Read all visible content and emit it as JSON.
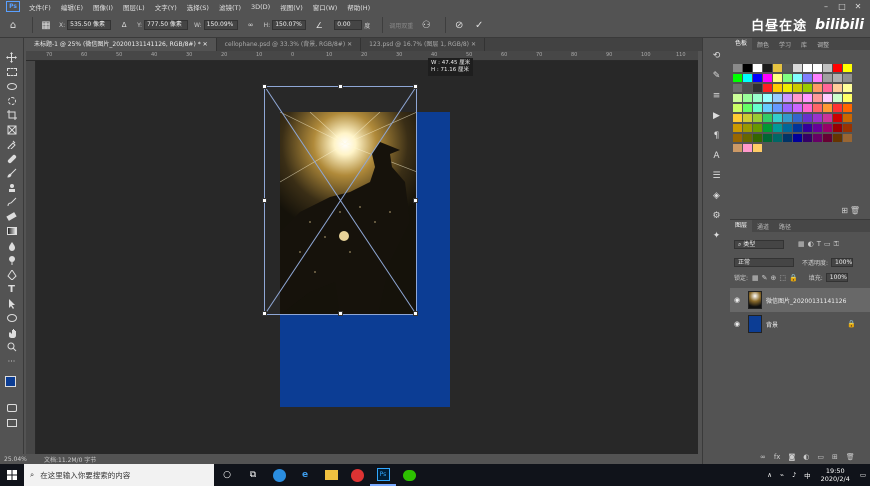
{
  "app": {
    "logo": "Ps"
  },
  "menu": [
    "文件(F)",
    "编辑(E)",
    "图像(I)",
    "图层(L)",
    "文字(Y)",
    "选择(S)",
    "滤镜(T)",
    "3D(D)",
    "视图(V)",
    "窗口(W)",
    "帮助(H)"
  ],
  "options": {
    "x_label": "X:",
    "x_value": "535.50 像素",
    "y_label": "Y:",
    "y_value": "777.50 像素",
    "w_label": "W:",
    "w_value": "150.09%",
    "h_label": "H:",
    "h_value": "150.07%",
    "angle_value": "0.00",
    "angle_unit": "度",
    "interp": "插值: 两次立方",
    "warp_label": "调用双重"
  },
  "watermark": {
    "text": "白昼在途",
    "logo": "bilibili"
  },
  "tabs": [
    {
      "label": "未标题-1 @ 25% (微信图片_20200131141126, RGB/8#) *",
      "active": true
    },
    {
      "label": "cellophane.psd @ 33.3% (背景, RGB/8#)",
      "active": false
    },
    {
      "label": "123.psd @ 16.7% (图层 1, RGB/8)",
      "active": false
    }
  ],
  "ruler_ticks": [
    "70",
    "60",
    "50",
    "40",
    "30",
    "20",
    "10",
    "0",
    "10",
    "20",
    "30",
    "40",
    "50",
    "60",
    "70",
    "80",
    "90",
    "100",
    "110"
  ],
  "tooltip": {
    "w": "W : 47.45 厘米",
    "h": "H : 71.16 厘米"
  },
  "status": {
    "zoom": "25.04%",
    "doc": "文档:11.2M/0 字节"
  },
  "swatch_tabs": [
    "色板",
    "颜色",
    "学习",
    "库",
    "调整"
  ],
  "swatches": [
    "#8a8a8a",
    "#000000",
    "#ffffff",
    "#1a1a1a",
    "#e6c341",
    "#5a5a5a",
    "#d9d9d9",
    "#ffffff",
    "#ffffff",
    "#c0c0c0",
    "#ff0000",
    "#ffff00",
    "#00ff00",
    "#00ffff",
    "#0000ff",
    "#ff00ff",
    "#ffff80",
    "#80ff80",
    "#80ffff",
    "#8080ff",
    "#ff80ff",
    "#a0a0a0",
    "#b0b0b0",
    "#909090",
    "#707070",
    "#505050",
    "#303030",
    "#ff2020",
    "#ffcc00",
    "#eeee00",
    "#cccc00",
    "#99cc00",
    "#ff9966",
    "#ff6699",
    "#ffcc99",
    "#ffff99",
    "#ccff99",
    "#99ff99",
    "#99ffcc",
    "#99ffff",
    "#99ccff",
    "#cc99ff",
    "#ff99cc",
    "#ff99ff",
    "#ff9999",
    "#ffccff",
    "#ccffcc",
    "#ffff66",
    "#ccff66",
    "#66ff66",
    "#66ffcc",
    "#66ccff",
    "#6699ff",
    "#9966ff",
    "#cc66ff",
    "#ff66cc",
    "#ff6666",
    "#ff9933",
    "#ff3333",
    "#ff6600",
    "#ffcc33",
    "#cccc33",
    "#99cc33",
    "#33cc66",
    "#33cccc",
    "#3399cc",
    "#3366cc",
    "#6633cc",
    "#9933cc",
    "#cc3399",
    "#cc0000",
    "#cc6600",
    "#cc9900",
    "#999900",
    "#669900",
    "#009933",
    "#009999",
    "#006699",
    "#003399",
    "#330099",
    "#660099",
    "#990066",
    "#990000",
    "#993300",
    "#996600",
    "#666600",
    "#336600",
    "#006633",
    "#006666",
    "#003366",
    "#000099",
    "#330066",
    "#660066",
    "#660033",
    "#663300",
    "#996633",
    "#cc9966",
    "#ff99cc",
    "#ffcc66"
  ],
  "layers_panel": {
    "tabs": [
      "图层",
      "通道",
      "路径"
    ],
    "filter": "类型",
    "blend_mode": "正常",
    "opacity_label": "不透明度:",
    "opacity": "100%",
    "lock_label": "锁定:",
    "fill_label": "填充:",
    "fill": "100%",
    "layers": [
      {
        "name": "微信图片_20200131141126",
        "selected": true
      },
      {
        "name": "背景",
        "selected": false
      }
    ]
  },
  "taskbar": {
    "search_placeholder": "在这里输入你要搜索的内容",
    "time": "19:50",
    "date": "2020/2/4",
    "ime": "中"
  },
  "colors": {
    "doc_blue": "#0c3d94",
    "canvas_bg": "#282828",
    "panel_bg": "#535353"
  }
}
